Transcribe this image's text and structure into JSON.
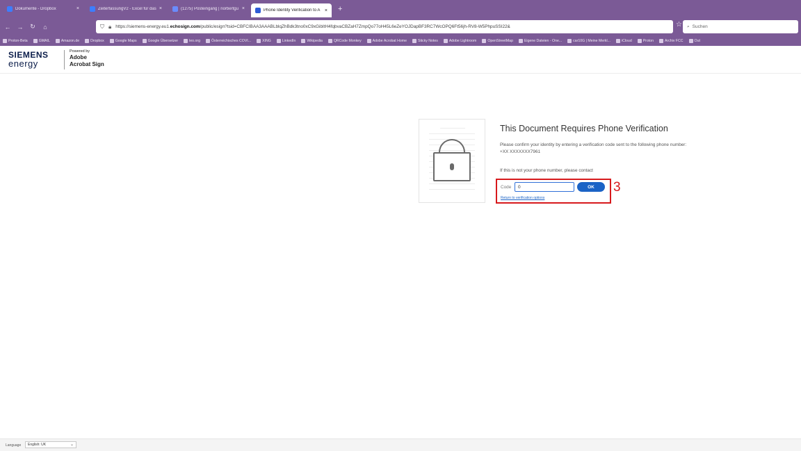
{
  "browser": {
    "tabs": [
      {
        "title": "Dokumente - Dropbox",
        "color": "#3d7eff",
        "active": false
      },
      {
        "title": "ZeiterfassungV2 - Excel für das",
        "color": "#3d7eff",
        "active": false
      },
      {
        "title": "(1275) Posteingang | norbertgu",
        "color": "#6a8cff",
        "active": false
      },
      {
        "title": "Phone Identity Verification to A",
        "color": "#2d5bd6",
        "active": true
      }
    ],
    "new_tab": "+",
    "url_prefix": "https://siemens-energy.eu1.",
    "url_domain": "echosign.com",
    "url_suffix": "/public/esign?tsid=CBFCIBAA3AAABLblqZhBdk3tno0xC9xGibItH4fqbvaCBZaH7ZmpQo77oH45L6eZeYOJDapBF3RC7WcOPQ6Ft56jh-RV8-W5PhpuSSI22&",
    "search_placeholder": "Suchen",
    "bookmarks": [
      "Proton-Beta",
      "GMAIL",
      "Amazon.de",
      "Dropbox",
      "Google Maps",
      "Google Übersetzer",
      "leo.org",
      "Österreichisches COVI...",
      "XING",
      "LinkedIn",
      "Wikipedia",
      "QRCode Monkey",
      "Adobe Acrobat Home",
      "Sticky Notes",
      "Adobe Lightroom",
      "OpenStreetMap",
      "Eigene Dateien - One...",
      "car10G | Meine Merkl...",
      "iCloud",
      "Proton",
      "Archiv FCC",
      "Out"
    ]
  },
  "header": {
    "logo_line1": "SIEMENS",
    "logo_line2": "energy",
    "powered_by": "Powered by",
    "adobe": "Adobe",
    "acrobat_sign": "Acrobat Sign"
  },
  "verification": {
    "title": "This Document Requires Phone Verification",
    "description": "Please confirm your identity by entering a verification code sent to the following phone number: +XX XXXXXXX7961",
    "contact": "If this is not your phone number, please contact",
    "code_label": "Code",
    "code_value": "0",
    "ok_label": "OK",
    "return_link": "Return to verification options",
    "step_number": "3"
  },
  "footer": {
    "language_label": "Language",
    "language_value": "English: UK"
  }
}
